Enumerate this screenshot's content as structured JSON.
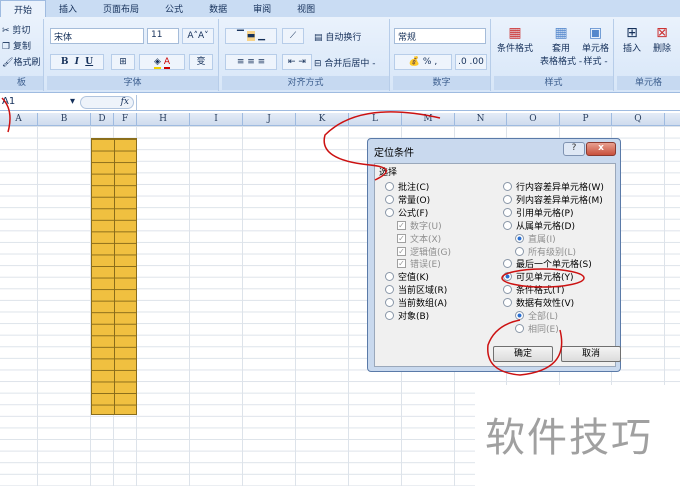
{
  "tabs": [
    "开始",
    "插入",
    "页面布局",
    "公式",
    "数据",
    "审阅",
    "视图"
  ],
  "clipboard": {
    "cut": "剪切",
    "copy": "复制",
    "format_painter": "格式刷",
    "label": "板"
  },
  "font": {
    "name": "宋体",
    "size": "11",
    "bold": "B",
    "italic": "I",
    "underline": "U",
    "label": "字体"
  },
  "alignment": {
    "wrap": "自动换行",
    "merge": "合并后居中 -",
    "label": "对齐方式"
  },
  "number": {
    "format": "常规",
    "percent": "%",
    "comma": ",",
    "label": "数字"
  },
  "styles": {
    "conditional": "条件格式",
    "table_l1": "套用",
    "table_l2": "表格格式 -",
    "cell_l1": "单元格",
    "cell_l2": "样式 -",
    "label": "样式"
  },
  "cells": {
    "insert": "插入",
    "delete": "删除",
    "label": "单元格"
  },
  "formula_bar": {
    "name_box": "A1",
    "fx": "fx",
    "value": ""
  },
  "columns": [
    "A",
    "B",
    "D",
    "F",
    "H",
    "I",
    "J",
    "K",
    "L",
    "M",
    "N",
    "O",
    "P",
    "Q"
  ],
  "colors": {
    "highlight": "#f0c040",
    "annotation": "#cc1111"
  },
  "dialog": {
    "title": "定位条件",
    "help": "?",
    "close": "x",
    "section": "选择",
    "left": [
      {
        "label": "批注(C)",
        "type": "radio"
      },
      {
        "label": "常量(O)",
        "type": "radio"
      },
      {
        "label": "公式(F)",
        "type": "radio"
      },
      {
        "label": "数字(U)",
        "type": "check",
        "disabled": true
      },
      {
        "label": "文本(X)",
        "type": "check",
        "disabled": true
      },
      {
        "label": "逻辑值(G)",
        "type": "check",
        "disabled": true
      },
      {
        "label": "错误(E)",
        "type": "check",
        "disabled": true
      },
      {
        "label": "空值(K)",
        "type": "radio"
      },
      {
        "label": "当前区域(R)",
        "type": "radio"
      },
      {
        "label": "当前数组(A)",
        "type": "radio"
      },
      {
        "label": "对象(B)",
        "type": "radio"
      }
    ],
    "right": [
      {
        "label": "行内容差异单元格(W)",
        "type": "radio"
      },
      {
        "label": "列内容差异单元格(M)",
        "type": "radio"
      },
      {
        "label": "引用单元格(P)",
        "type": "radio"
      },
      {
        "label": "从属单元格(D)",
        "type": "radio"
      },
      {
        "label": "直属(I)",
        "type": "radio",
        "disabled": true,
        "checked": true
      },
      {
        "label": "所有级别(L)",
        "type": "radio",
        "disabled": true
      },
      {
        "label": "最后一个单元格(S)",
        "type": "radio"
      },
      {
        "label": "可见单元格(Y)",
        "type": "radio",
        "checked": true
      },
      {
        "label": "条件格式(T)",
        "type": "radio"
      },
      {
        "label": "数据有效性(V)",
        "type": "radio"
      },
      {
        "label": "全部(L)",
        "type": "radio",
        "disabled": true,
        "checked": true
      },
      {
        "label": "相同(E)",
        "type": "radio",
        "disabled": true
      }
    ],
    "ok": "确定",
    "cancel": "取消"
  },
  "watermark": "软件技巧"
}
